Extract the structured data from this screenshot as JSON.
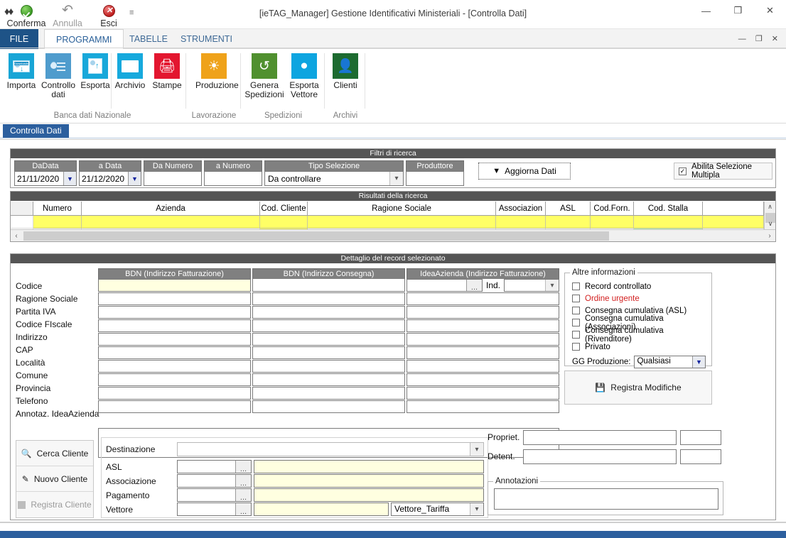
{
  "window": {
    "title": "[ieTAG_Manager] Gestione Identificativi Ministeriali - [Controlla Dati]",
    "minimize": "—",
    "maximize": "❒",
    "close": "✕",
    "logo_icon": "app-logo-icon"
  },
  "quick_access": {
    "items": [
      {
        "label": "Conferma",
        "icon": "confirm-green-check-icon",
        "disabled": false
      },
      {
        "label": "Annulla",
        "icon": "undo-arrow-icon",
        "disabled": true
      },
      {
        "label": "Esci",
        "icon": "exit-red-icon",
        "disabled": false
      }
    ],
    "more_icon": "☰"
  },
  "ribbon": {
    "tabs": [
      {
        "label": "FILE",
        "active": false,
        "file": true
      },
      {
        "label": "PROGRAMMI",
        "active": true,
        "file": false
      },
      {
        "label": "TABELLE",
        "active": false,
        "file": false
      },
      {
        "label": "STRUMENTI",
        "active": false,
        "file": false
      }
    ],
    "minimize_glyph": "— ❐ ✕",
    "groups": [
      {
        "name": "Banca dati Nazionale",
        "items": [
          {
            "label": "Importa",
            "icon": "import-download-icon"
          },
          {
            "label": "Controllo dati",
            "icon": "control-data-icon"
          },
          {
            "label": "Esporta",
            "icon": "export-upload-icon"
          }
        ]
      },
      {
        "name": "",
        "items": [
          {
            "label": "Archivio",
            "icon": "folder-icon"
          },
          {
            "label": "Stampe",
            "icon": "printer-icon"
          }
        ]
      },
      {
        "name": "Lavorazione",
        "items": [
          {
            "label": "Produzione",
            "icon": "sun-gear-icon"
          }
        ]
      },
      {
        "name": "Spedizioni",
        "items": [
          {
            "label": "Genera Spedizioni",
            "icon": "refresh-cycle-icon"
          },
          {
            "label": "Esporta Vettore",
            "icon": "usb-stick-icon"
          }
        ]
      },
      {
        "name": "Archivi",
        "items": [
          {
            "label": "Clienti",
            "icon": "person-icon"
          }
        ]
      }
    ]
  },
  "document_tab": {
    "label": "Controlla Dati"
  },
  "filters": {
    "title": "Filtri di ricerca",
    "fields": [
      {
        "name": "da-data",
        "caption": "DaData",
        "value": "21/11/2020",
        "type": "date"
      },
      {
        "name": "a-data",
        "caption": "a Data",
        "value": "21/12/2020",
        "type": "date"
      },
      {
        "name": "da-numero",
        "caption": "Da Numero",
        "value": "",
        "type": "text"
      },
      {
        "name": "a-numero",
        "caption": "a Numero",
        "value": "",
        "type": "text"
      },
      {
        "name": "tipo-selezione",
        "caption": "Tipo Selezione",
        "value": "Da controllare",
        "type": "combo"
      },
      {
        "name": "produttore",
        "caption": "Produttore",
        "value": "",
        "type": "text"
      }
    ],
    "refresh_button": {
      "label": "Aggiorna Dati",
      "icon": "funnel-filter-icon"
    },
    "multi_select": {
      "label": "Abilita Selezione Multipla",
      "checked": true,
      "check_glyph": "✓"
    }
  },
  "results": {
    "title": "Risultati della ricerca",
    "columns": [
      "Numero",
      "Azienda",
      "Cod. Cliente",
      "Ragione Sociale",
      "Associazion",
      "ASL",
      "Cod.Forn.",
      "Cod. Stalla"
    ],
    "rows": [
      {
        "cells": [
          "",
          "",
          "",
          "",
          "",
          "",
          "",
          ""
        ],
        "highlight": "yellow"
      },
      {
        "cells": [
          "",
          "",
          "",
          "",
          "",
          "",
          "",
          ""
        ],
        "highlight": "partial"
      }
    ],
    "scroll": {
      "up": "∧",
      "down": "∨",
      "left": "‹",
      "right": "›"
    }
  },
  "detail": {
    "title": "Dettaglio del record selezionato",
    "row_labels": [
      "Codice",
      "Ragione Sociale",
      "Partita IVA",
      "Codice FIscale",
      "Indirizzo",
      "CAP",
      "Località",
      "Comune",
      "Provincia",
      "Telefono",
      "Annotaz. IdeaAzienda"
    ],
    "columns": [
      {
        "name": "bdn-fatturazione",
        "header": "BDN (Indirizzo Fatturazione)"
      },
      {
        "name": "bdn-consegna",
        "header": "BDN (Indirizzo Consegna)"
      },
      {
        "name": "ideaazienda-fatt",
        "header": "IdeaAzienda (Indirizzo Fatturazione)"
      }
    ],
    "ideaazienda_first_row": {
      "ellipsis": "...",
      "ind_label": "Ind.",
      "combo_value": ""
    },
    "values": {
      "bdn_fatturazione": [
        "",
        "",
        "",
        "",
        "",
        "",
        "",
        "",
        "",
        ""
      ],
      "bdn_consegna": [
        "",
        "",
        "",
        "",
        "",
        "",
        "",
        "",
        "",
        ""
      ],
      "ideaazienda": [
        "",
        "",
        "",
        "",
        "",
        "",
        "",
        "",
        ""
      ]
    },
    "annotation_value": ""
  },
  "other_info": {
    "caption": "Altre informazioni",
    "checkboxes": [
      {
        "label": "Record controllato",
        "checked": false,
        "color": "#111111"
      },
      {
        "label": "Ordine urgente",
        "checked": false,
        "color": "#d21f1f"
      },
      {
        "label": "Consegna cumulativa (ASL)",
        "checked": false,
        "color": "#111111"
      },
      {
        "label": "Consegna cumulativa (Associazioni)",
        "checked": false,
        "color": "#111111"
      },
      {
        "label": "Consegna cumulativa (Rivenditore)",
        "checked": false,
        "color": "#111111"
      },
      {
        "label": "Privato",
        "checked": false,
        "color": "#111111"
      }
    ],
    "gg_produzione": {
      "label": "GG Produzione:",
      "value": "Qualsiasi"
    },
    "save_button": {
      "label": "Registra Modifiche",
      "icon": "floppy-save-icon"
    }
  },
  "client_actions": {
    "buttons": [
      {
        "label": "Cerca Cliente",
        "icon": "magnifier-key-icon",
        "disabled": false
      },
      {
        "label": "Nuovo Cliente",
        "icon": "pencil-icon",
        "disabled": false
      },
      {
        "label": "Registra Cliente",
        "icon": "floppy-save-icon",
        "disabled": true
      }
    ]
  },
  "bottom_form": {
    "rows": [
      {
        "name": "destinazione",
        "label": "Destinazione",
        "type": "combo",
        "value": ""
      },
      {
        "name": "asl",
        "label": "ASL",
        "type": "lookup",
        "code": "",
        "value": ""
      },
      {
        "name": "associazione",
        "label": "Associazione",
        "type": "lookup",
        "code": "",
        "value": ""
      },
      {
        "name": "pagamento",
        "label": "Pagamento",
        "type": "lookup",
        "code": "",
        "value": ""
      },
      {
        "name": "vettore",
        "label": "Vettore",
        "type": "lookup-combo",
        "code": "",
        "value": "",
        "combo_value": "Vettore_Tariffa"
      }
    ],
    "ellipsis": "...",
    "owner_rows": [
      {
        "name": "proprietario",
        "label": "Propriet.",
        "value": "",
        "extra": ""
      },
      {
        "name": "detentore",
        "label": "Detent.",
        "value": "",
        "extra": ""
      }
    ],
    "annotations": {
      "caption": "Annotazioni",
      "value": ""
    }
  }
}
